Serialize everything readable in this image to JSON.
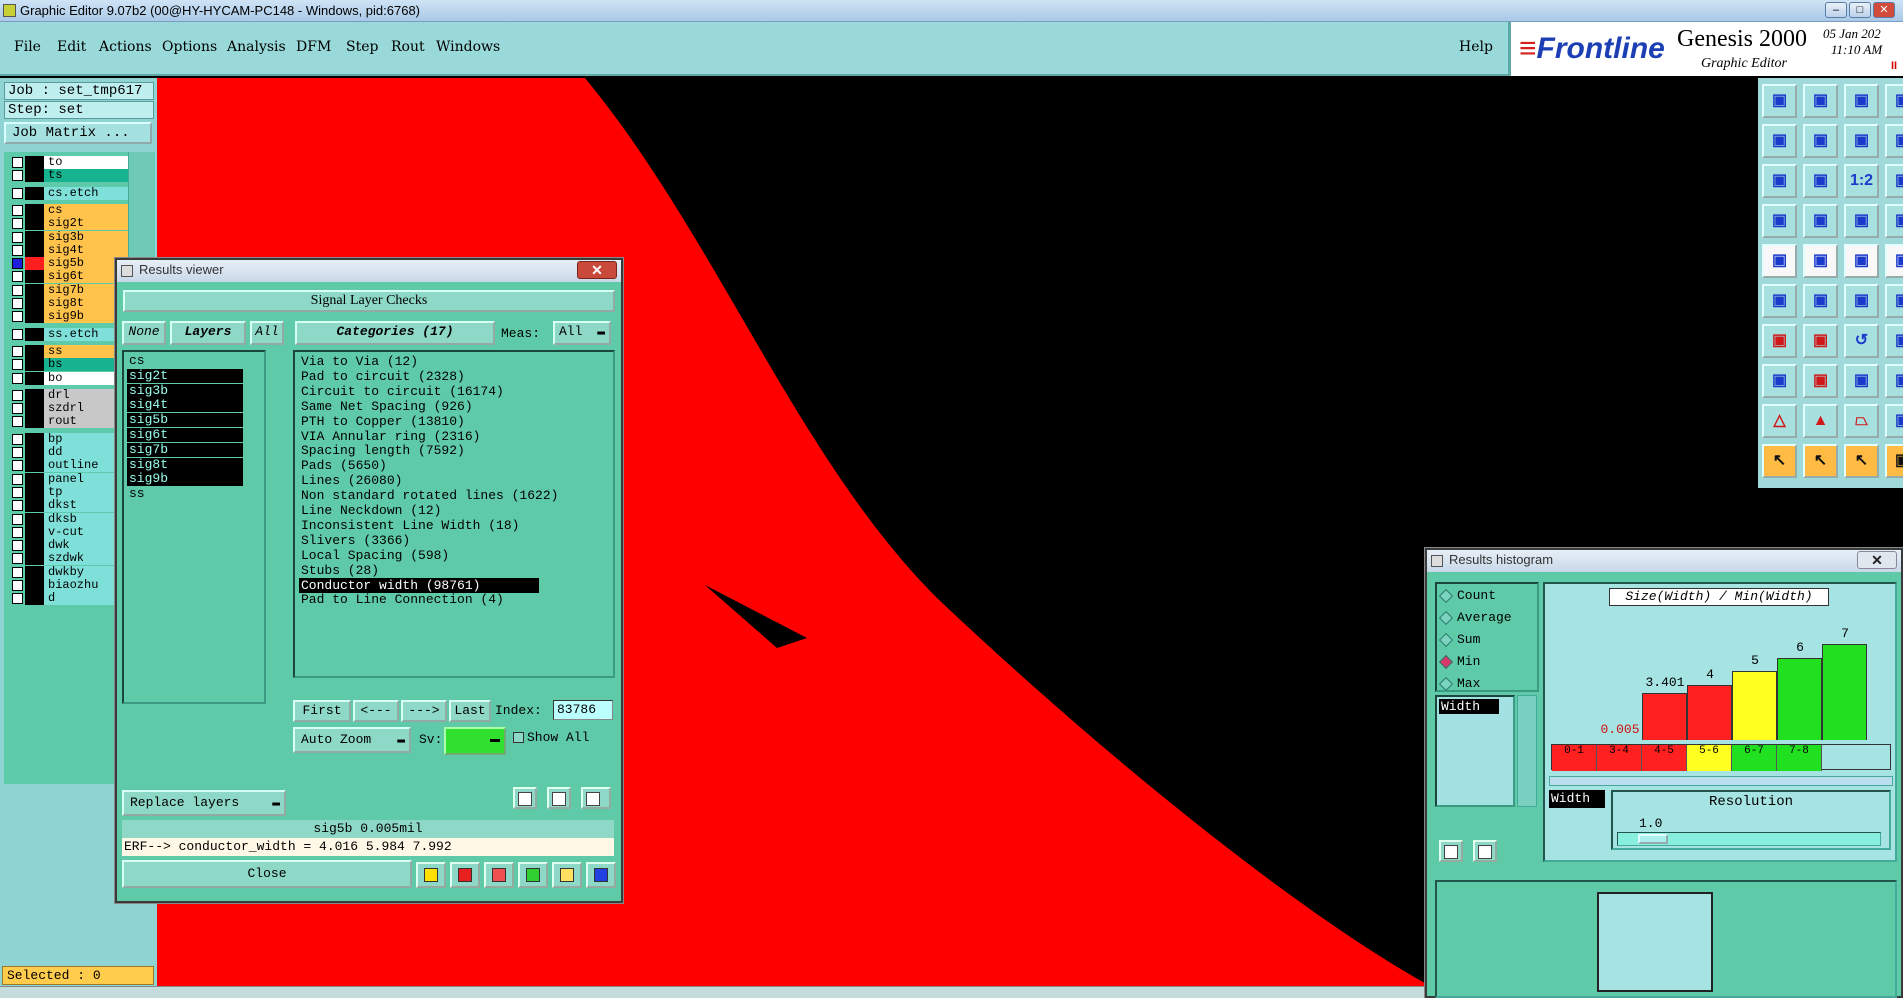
{
  "window": {
    "title": "Graphic Editor 9.07b2 (00@HY-HYCAM-PC148 - Windows, pid:6768)"
  },
  "menu": {
    "items": [
      "File",
      "Edit",
      "Actions",
      "Options",
      "Analysis",
      "DFM",
      "Step",
      "Rout",
      "Windows"
    ],
    "help": "Help"
  },
  "brand": {
    "logo": "Frontline",
    "product": "Genesis 2000",
    "subtitle": "Graphic Editor",
    "date": "05 Jan 202",
    "time": "11:10 AM",
    "pause": "II"
  },
  "left": {
    "job": "Job : set_tmp617",
    "step": "Step: set",
    "job_matrix": "Job Matrix ...",
    "selected": "Selected : 0",
    "layers": [
      {
        "name": "to",
        "color": "#ffffff"
      },
      {
        "name": "ts",
        "color": "#17b391"
      },
      {
        "name": "cs.etch",
        "color": "#7fe0d9"
      },
      {
        "name": "cs",
        "color": "#ffc34c"
      },
      {
        "name": "sig2t",
        "color": "#ffc34c"
      },
      {
        "name": "sig3b",
        "color": "#ffc34c"
      },
      {
        "name": "sig4t",
        "color": "#ffc34c"
      },
      {
        "name": "sig5b",
        "color": "#ffc34c"
      },
      {
        "name": "sig6t",
        "color": "#ffc34c"
      },
      {
        "name": "sig7b",
        "color": "#ffc34c"
      },
      {
        "name": "sig8t",
        "color": "#ffc34c"
      },
      {
        "name": "sig9b",
        "color": "#ffc34c"
      },
      {
        "name": "ss.etch",
        "color": "#7fe0d9"
      },
      {
        "name": "ss",
        "color": "#ffc34c"
      },
      {
        "name": "bs",
        "color": "#17b391"
      },
      {
        "name": "bo",
        "color": "#ffffff"
      },
      {
        "name": "drl",
        "color": "#c8c8c8"
      },
      {
        "name": "szdrl",
        "color": "#c8c8c8"
      },
      {
        "name": "rout",
        "color": "#c8c8c8"
      },
      {
        "name": "bp",
        "color": "#7fe0d9"
      },
      {
        "name": "dd",
        "color": "#7fe0d9"
      },
      {
        "name": "outline",
        "color": "#7fe0d9"
      },
      {
        "name": "panel",
        "color": "#7fe0d9"
      },
      {
        "name": "tp",
        "color": "#7fe0d9"
      },
      {
        "name": "dkst",
        "color": "#7fe0d9"
      },
      {
        "name": "dksb",
        "color": "#7fe0d9"
      },
      {
        "name": "v-cut",
        "color": "#7fe0d9"
      },
      {
        "name": "dwk",
        "color": "#7fe0d9"
      },
      {
        "name": "szdwk",
        "color": "#7fe0d9"
      },
      {
        "name": "dwkby",
        "color": "#7fe0d9"
      },
      {
        "name": "biaozhu",
        "color": "#7fe0d9"
      },
      {
        "name": "d",
        "color": "#7fe0d9"
      }
    ]
  },
  "results_viewer": {
    "title": "Results viewer",
    "header": "Signal Layer Checks",
    "none": "None",
    "layers_tab": "Layers",
    "all": "All",
    "categories_tab": "Categories (17)",
    "meas_label": "Meas:",
    "meas_value": "All",
    "layers": [
      "cs",
      "sig2t",
      "sig3b",
      "sig4t",
      "sig5b",
      "sig6t",
      "sig7b",
      "sig8t",
      "sig9b",
      "ss"
    ],
    "categories": [
      "Via to Via (12)",
      "Pad to circuit (2328)",
      "Circuit to circuit (16174)",
      "Same Net Spacing (926)",
      "PTH to Copper (13810)",
      "VIA Annular ring (2316)",
      "Spacing length (7592)",
      "Pads (5650)",
      "Lines (26080)",
      "Non standard rotated lines (1622)",
      "Line Neckdown (12)",
      "Inconsistent Line Width (18)",
      "Slivers (3366)",
      "Local Spacing (598)",
      "Stubs (28)",
      "Conductor width (98761)",
      "Pad to Line Connection (4)"
    ],
    "first": "First",
    "prev": "<---",
    "next": "--->",
    "last": "Last",
    "index_label": "Index:",
    "index_value": "83786",
    "auto_zoom": "Auto Zoom",
    "sv_label": "Sv:",
    "show_all": "Show All",
    "replace_layers": "Replace layers",
    "status": "sig5b 0.005mil",
    "erf": "ERF--> conductor_width = 4.016 5.984 7.992",
    "close": "Close",
    "mini_labels": [
      "DEL",
      "REF",
      "DATA"
    ]
  },
  "histogram": {
    "title": "Results histogram",
    "options": [
      "Count",
      "Average",
      "Sum",
      "Min",
      "Max"
    ],
    "selected_option": "Min",
    "field_item": "Width",
    "chart_title": "Size(Width) / Min(Width)",
    "resolution_label": "Resolution",
    "resolution_value": "1.0",
    "width_tag": "Width",
    "mini_labels": [
      "DEL",
      "REF"
    ],
    "bars": [
      {
        "bin": "0-1",
        "value": "0.005",
        "color": "#ff2020",
        "level": 0.0
      },
      {
        "bin": "3-4",
        "value": "3.401",
        "color": "#ff2020",
        "level": 0.486
      },
      {
        "bin": "4-5",
        "value": "4",
        "color": "#ff2020",
        "level": 0.571
      },
      {
        "bin": "5-6",
        "value": "5",
        "color": "#ffff20",
        "level": 0.714
      },
      {
        "bin": "6-7",
        "value": "6",
        "color": "#20e020",
        "level": 0.857
      },
      {
        "bin": "7-8",
        "value": "7",
        "color": "#20e020",
        "level": 1.0
      }
    ]
  },
  "colors": {
    "panel_teal": "#5fcaa8",
    "menu_bg": "#99d9d9",
    "board_red": "#ff0000",
    "canvas": "#000000"
  }
}
